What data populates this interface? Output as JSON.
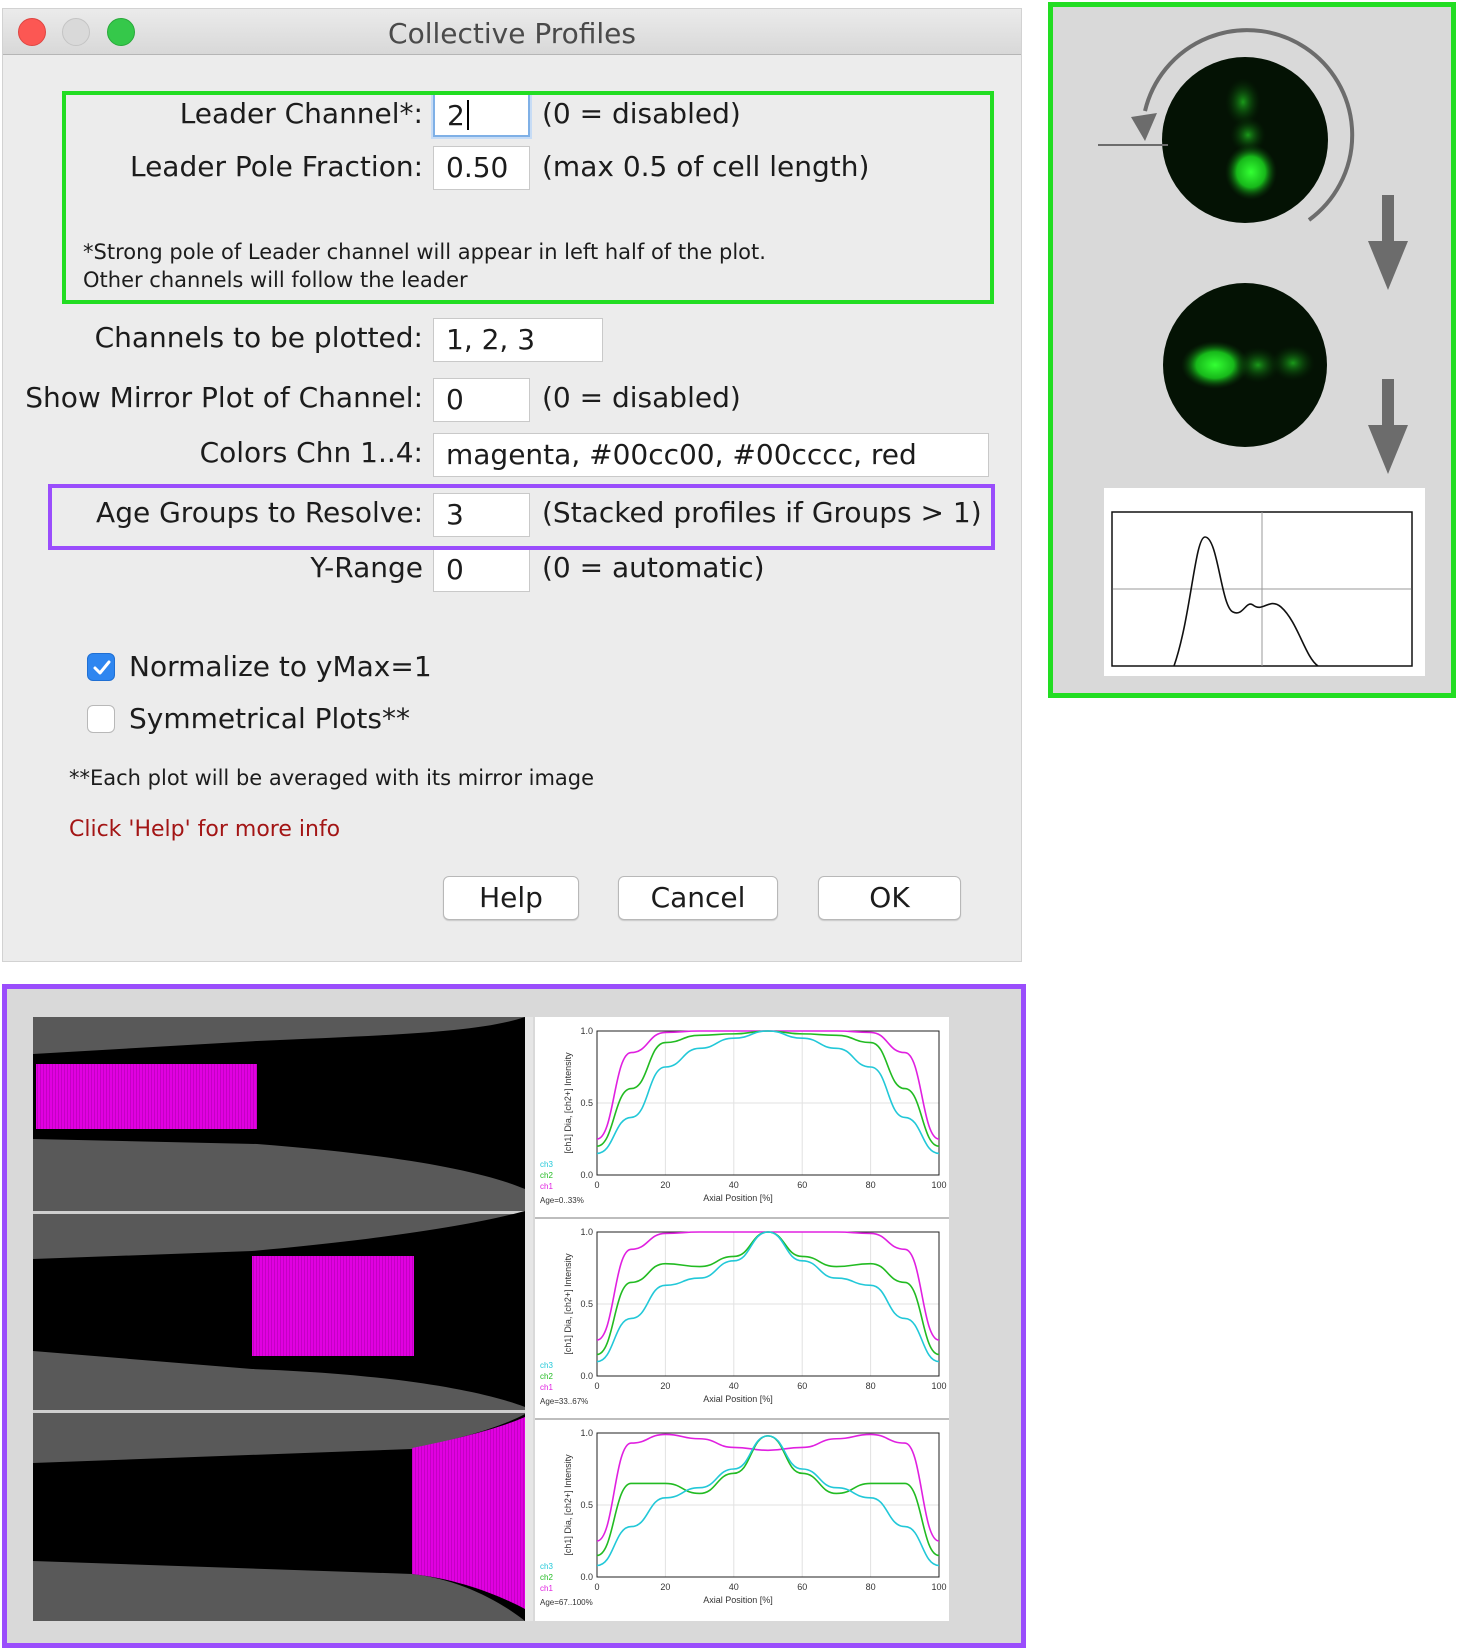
{
  "dialog": {
    "title": "Collective Profiles",
    "leader_channel": {
      "label": "Leader Channel*:",
      "value": "2",
      "hint": "(0 = disabled)"
    },
    "leader_pole_fraction": {
      "label": "Leader Pole Fraction:",
      "value": "0.50",
      "hint": "(max 0.5 of cell length)"
    },
    "leader_note_1": "*Strong pole of Leader channel will appear in left half of the plot.",
    "leader_note_2": "Other channels will follow the leader",
    "channels": {
      "label": "Channels to be plotted:",
      "value": "1, 2, 3"
    },
    "mirror": {
      "label": "Show Mirror Plot of Channel:",
      "value": "0",
      "hint": "(0 = disabled)"
    },
    "colors": {
      "label": "Colors Chn 1..4:",
      "value": "magenta, #00cc00, #00cccc, red"
    },
    "age_groups": {
      "label": "Age Groups to Resolve:",
      "value": "3",
      "hint": "(Stacked profiles if Groups > 1)"
    },
    "y_range": {
      "label": "Y-Range",
      "value": "0",
      "hint": "(0 = automatic)"
    },
    "normalize": {
      "label": "Normalize to yMax=1",
      "checked": true
    },
    "symmetrical": {
      "label": "Symmetrical Plots**",
      "checked": false
    },
    "sym_note": "**Each plot will be averaged with its mirror image",
    "help_text": "Click 'Help' for more info",
    "buttons": {
      "help": "Help",
      "cancel": "Cancel",
      "ok": "OK"
    }
  },
  "accent_colors": {
    "leader_box": "#22dd22",
    "age_box": "#9a4dfc",
    "ch1": "#e020e0",
    "ch2": "#22bb22",
    "ch3": "#22c8d8"
  },
  "profile_plots": {
    "y_axis_label": "[ch1] Dia, [ch2+] Intensity",
    "x_axis_label": "Axial Position [%]",
    "y_ticks": [
      "0.0",
      "0.5",
      "1.0"
    ],
    "x_ticks": [
      "0",
      "20",
      "40",
      "60",
      "80",
      "100"
    ],
    "legend": [
      "ch3",
      "ch2",
      "ch1"
    ],
    "panels": [
      {
        "age": "Age=0..33%"
      },
      {
        "age": "Age=33..67%"
      },
      {
        "age": "Age=67..100%"
      }
    ]
  },
  "chart_data": [
    {
      "type": "line",
      "x": [
        0,
        10,
        20,
        30,
        40,
        50,
        60,
        70,
        80,
        90,
        100
      ],
      "ylim": [
        0,
        1
      ],
      "xlim": [
        0,
        100
      ],
      "xlabel": "Axial Position [%]",
      "ylabel": "[ch1] Dia, [ch2+] Intensity",
      "series": [
        {
          "name": "ch1",
          "values": [
            0.25,
            0.85,
            0.99,
            1.0,
            1.0,
            1.0,
            1.0,
            1.0,
            0.99,
            0.85,
            0.25
          ]
        },
        {
          "name": "ch2",
          "values": [
            0.2,
            0.6,
            0.92,
            0.97,
            0.98,
            1.0,
            0.98,
            0.97,
            0.92,
            0.6,
            0.2
          ]
        },
        {
          "name": "ch3",
          "values": [
            0.15,
            0.4,
            0.75,
            0.88,
            0.95,
            1.0,
            0.95,
            0.88,
            0.75,
            0.4,
            0.15
          ]
        }
      ]
    },
    {
      "type": "line",
      "x": [
        0,
        10,
        20,
        30,
        40,
        50,
        60,
        70,
        80,
        90,
        100
      ],
      "ylim": [
        0,
        1
      ],
      "xlim": [
        0,
        100
      ],
      "xlabel": "Axial Position [%]",
      "ylabel": "[ch1] Dia, [ch2+] Intensity",
      "series": [
        {
          "name": "ch1",
          "values": [
            0.25,
            0.88,
            0.99,
            1.0,
            1.0,
            1.0,
            1.0,
            1.0,
            0.99,
            0.88,
            0.25
          ]
        },
        {
          "name": "ch2",
          "values": [
            0.15,
            0.65,
            0.78,
            0.76,
            0.83,
            1.0,
            0.83,
            0.76,
            0.78,
            0.65,
            0.15
          ]
        },
        {
          "name": "ch3",
          "values": [
            0.1,
            0.4,
            0.63,
            0.68,
            0.8,
            1.0,
            0.8,
            0.68,
            0.63,
            0.4,
            0.1
          ]
        }
      ]
    },
    {
      "type": "line",
      "x": [
        0,
        10,
        20,
        30,
        40,
        50,
        60,
        70,
        80,
        90,
        100
      ],
      "ylim": [
        0,
        1
      ],
      "xlim": [
        0,
        100
      ],
      "xlabel": "Axial Position [%]",
      "ylabel": "[ch1] Dia, [ch2+] Intensity",
      "series": [
        {
          "name": "ch1",
          "values": [
            0.25,
            0.93,
            0.99,
            0.96,
            0.9,
            0.88,
            0.9,
            0.96,
            0.99,
            0.93,
            0.25
          ]
        },
        {
          "name": "ch2",
          "values": [
            0.15,
            0.65,
            0.65,
            0.58,
            0.72,
            0.98,
            0.72,
            0.58,
            0.65,
            0.65,
            0.15
          ]
        },
        {
          "name": "ch3",
          "values": [
            0.08,
            0.35,
            0.55,
            0.62,
            0.75,
            0.98,
            0.75,
            0.62,
            0.55,
            0.35,
            0.08
          ]
        }
      ]
    }
  ]
}
